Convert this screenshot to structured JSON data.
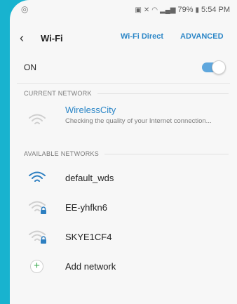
{
  "status_bar": {
    "icons": [
      "notification-icon",
      "sync-icon",
      "mute-icon",
      "wifi-icon",
      "signal-icon"
    ],
    "battery": "79%",
    "time": "5:54 PM"
  },
  "header": {
    "title": "Wi-Fi",
    "wifi_direct": "Wi-Fi Direct",
    "advanced": "ADVANCED"
  },
  "master_toggle": {
    "label": "ON",
    "state": true
  },
  "current_network": {
    "section_label": "CURRENT NETWORK",
    "name": "WirelessCity",
    "status": "Checking the quality of your Internet connection..."
  },
  "available": {
    "section_label": "AVAILABLE NETWORKS",
    "networks": [
      {
        "ssid": "default_wds",
        "secured": false
      },
      {
        "ssid": "EE-yhfkn6",
        "secured": true
      },
      {
        "ssid": "SKYE1CF4",
        "secured": true
      }
    ],
    "add_label": "Add network"
  },
  "colors": {
    "accent": "#2b86c7",
    "background": "#18b3cf",
    "toggle": "#5fa7dd",
    "add": "#3aa94f"
  }
}
